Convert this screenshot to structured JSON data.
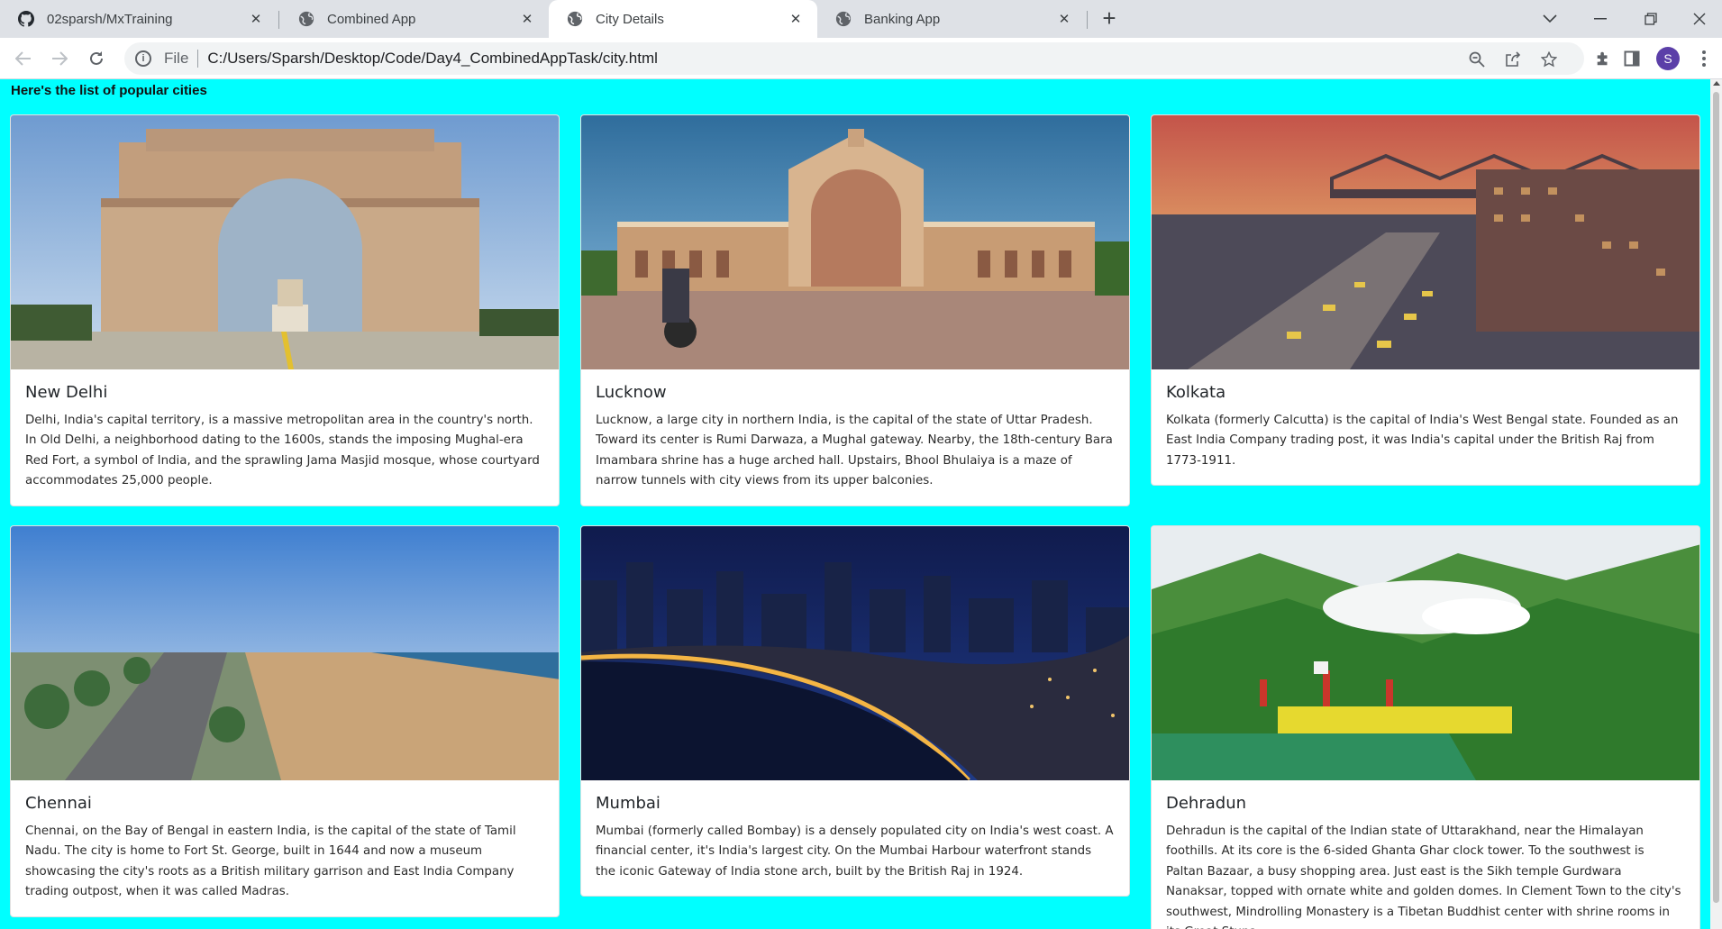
{
  "browser": {
    "tabs": [
      {
        "title": "02sparsh/MxTraining",
        "icon": "github-icon"
      },
      {
        "title": "Combined App",
        "icon": "globe-icon"
      },
      {
        "title": "City Details",
        "icon": "globe-icon",
        "active": true
      },
      {
        "title": "Banking App",
        "icon": "globe-icon"
      }
    ],
    "address": {
      "scheme": "File",
      "url": "C:/Users/Sparsh/Desktop/Code/Day4_CombinedAppTask/city.html"
    },
    "profile_initial": "S"
  },
  "page": {
    "heading": "Here's the list of popular cities",
    "cities": [
      {
        "name": "New Delhi",
        "image": "india-gate-photo",
        "description": "Delhi, India's capital territory, is a massive metropolitan area in the country's north. In Old Delhi, a neighborhood dating to the 1600s, stands the imposing Mughal-era Red Fort, a symbol of India, and the sprawling Jama Masjid mosque, whose courtyard accommodates 25,000 people."
      },
      {
        "name": "Lucknow",
        "image": "rumi-darwaza-photo",
        "description": "Lucknow, a large city in northern India, is the capital of the state of Uttar Pradesh. Toward its center is Rumi Darwaza, a Mughal gateway. Nearby, the 18th-century Bara Imambara shrine has a huge arched hall. Upstairs, Bhool Bhulaiya is a maze of narrow tunnels with city views from its upper balconies."
      },
      {
        "name": "Kolkata",
        "image": "kolkata-howrah-bridge-photo",
        "description": "Kolkata (formerly Calcutta) is the capital of India's West Bengal state. Founded as an East India Company trading post, it was India's capital under the British Raj from 1773-1911."
      },
      {
        "name": "Chennai",
        "image": "marina-beach-photo",
        "description": "Chennai, on the Bay of Bengal in eastern India, is the capital of the state of Tamil Nadu. The city is home to Fort St. George, built in 1644 and now a museum showcasing the city's roots as a British military garrison and East India Company trading outpost, when it was called Madras."
      },
      {
        "name": "Mumbai",
        "image": "marine-drive-night-photo",
        "description": "Mumbai (formerly called Bombay) is a densely populated city on India's west coast. A financial center, it's India's largest city. On the Mumbai Harbour waterfront stands the iconic Gateway of India stone arch, built by the British Raj in 1924."
      },
      {
        "name": "Dehradun",
        "image": "dehradun-hills-photo",
        "description": "Dehradun is the capital of the Indian state of Uttarakhand, near the Himalayan foothills. At its core is the 6-sided Ghanta Ghar clock tower. To the southwest is Paltan Bazaar, a busy shopping area. Just east is the Sikh temple Gurdwara Nanaksar, topped with ornate white and golden domes. In Clement Town to the city's southwest, Mindrolling Monastery is a Tibetan Buddhist center with shrine rooms in its Great Stupa."
      }
    ]
  }
}
